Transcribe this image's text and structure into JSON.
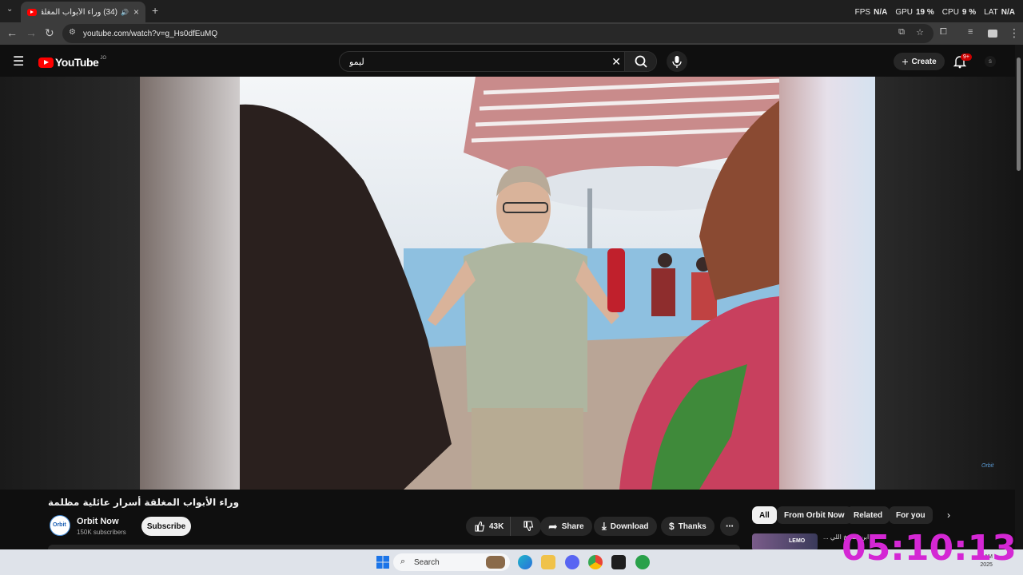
{
  "browser": {
    "tab_title": "(34) وراء الأبواب المغلقة أسرار",
    "url": "youtube.com/watch?v=g_Hs0dfEuMQ",
    "stats": [
      {
        "label": "FPS",
        "value": "N/A"
      },
      {
        "label": "GPU",
        "value": "19 %"
      },
      {
        "label": "CPU",
        "value": "9 %"
      },
      {
        "label": "LAT",
        "value": "N/A"
      }
    ]
  },
  "youtube": {
    "logo_text": "YouTube",
    "country_code": "JO",
    "search_value": "ليمو",
    "create_label": "Create",
    "notif_badge": "9+"
  },
  "video": {
    "title": "وراء الأبواب المغلقة أسرار عائلية مظلمة",
    "channel_name": "Orbit Now",
    "channel_avatar_text": "Orbit",
    "subscribers": "150K subscribers",
    "subscribe_label": "Subscribe",
    "likes": "43K",
    "share_label": "Share",
    "download_label": "Download",
    "thanks_label": "Thanks",
    "watermark": "Orbit"
  },
  "chips": [
    "All",
    "From Orbit Now",
    "Related",
    "For you"
  ],
  "related": {
    "title_snippet": "ابن الشيخ اللي ...",
    "thumb_label": "LEMO"
  },
  "overlay_clock": "05:10:13",
  "taskbar": {
    "search_placeholder": "Search",
    "time": "9 AM",
    "date": "2025"
  },
  "colors": {
    "yt_red": "#ff0000",
    "clock_magenta": "#d427d4",
    "bg": "#0f0f0f"
  }
}
